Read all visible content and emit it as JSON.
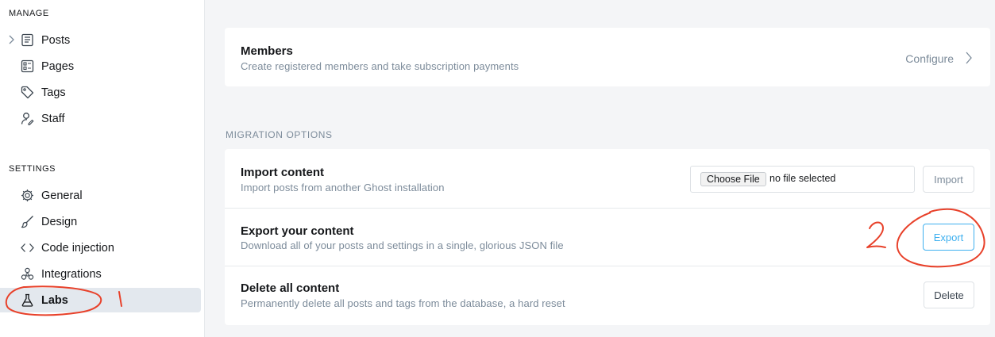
{
  "sidebar": {
    "manage_title": "MANAGE",
    "manage_items": [
      {
        "label": "Posts",
        "icon": "posts-icon"
      },
      {
        "label": "Pages",
        "icon": "pages-icon"
      },
      {
        "label": "Tags",
        "icon": "tag-icon"
      },
      {
        "label": "Staff",
        "icon": "staff-icon"
      }
    ],
    "settings_title": "SETTINGS",
    "settings_items": [
      {
        "label": "General",
        "icon": "gear-icon"
      },
      {
        "label": "Design",
        "icon": "brush-icon"
      },
      {
        "label": "Code injection",
        "icon": "code-icon"
      },
      {
        "label": "Integrations",
        "icon": "integrations-icon"
      },
      {
        "label": "Labs",
        "icon": "flask-icon",
        "active": true
      }
    ]
  },
  "members": {
    "title": "Members",
    "description": "Create registered members and take subscription payments",
    "configure_label": "Configure"
  },
  "migration": {
    "section_title": "MIGRATION OPTIONS",
    "import": {
      "title": "Import content",
      "description": "Import posts from another Ghost installation",
      "choose_file_label": "Choose File",
      "file_status": "no file selected",
      "button_label": "Import"
    },
    "export": {
      "title": "Export your content",
      "description": "Download all of your posts and settings in a single, glorious JSON file",
      "button_label": "Export"
    },
    "delete": {
      "title": "Delete all content",
      "description": "Permanently delete all posts and tags from the database, a hard reset",
      "button_label": "Delete"
    }
  },
  "annotations": {
    "step1_mark": "1",
    "step2_mark": "2",
    "color": "#e8412a"
  },
  "colors": {
    "accent": "#3eb0ef",
    "active_bg": "#e3e8ee",
    "muted_text": "#7c8b9a"
  }
}
